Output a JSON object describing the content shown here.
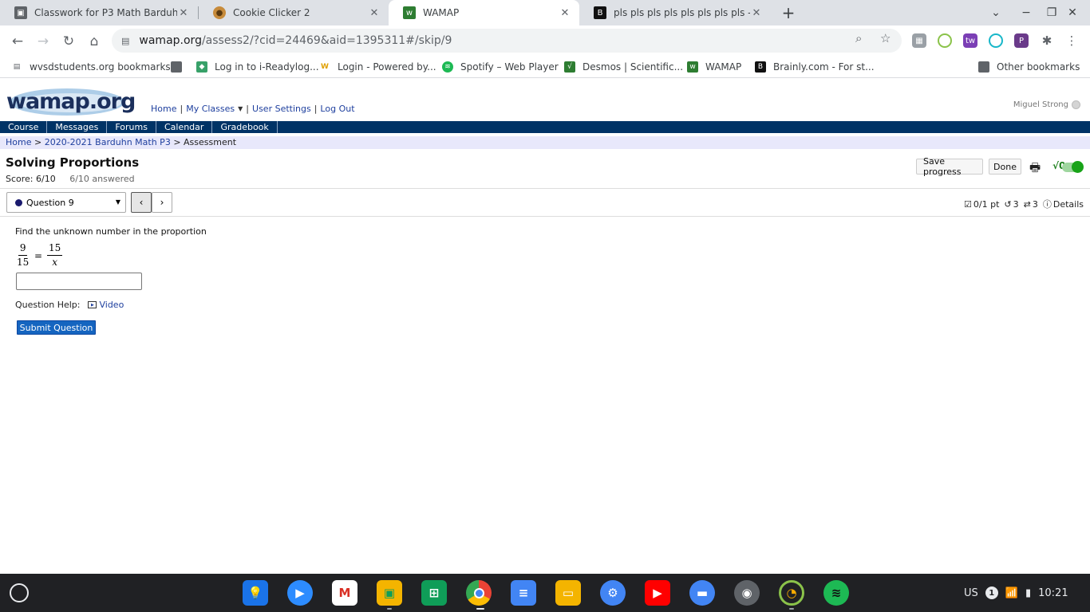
{
  "browser": {
    "tabs": [
      {
        "title": "Classwork for P3 Math Barduhn",
        "icon": "classroom-icon"
      },
      {
        "title": "Cookie Clicker 2",
        "icon": "cookie-icon"
      },
      {
        "title": "WAMAP",
        "icon": "wamap-icon"
      },
      {
        "title": "pls pls pls pls pls pls pls pls -",
        "icon": "brainly-icon"
      }
    ],
    "url_host": "wamap.org",
    "url_path": "/assess2/?cid=24469&aid=1395311#/skip/9",
    "bookmarks": [
      {
        "label": "wvsdstudents.org bookmarks"
      },
      {
        "label": ""
      },
      {
        "label": "Log in to i-Readylog..."
      },
      {
        "label": "Login - Powered by..."
      },
      {
        "label": "Spotify – Web Player"
      },
      {
        "label": "Desmos | Scientific..."
      },
      {
        "label": "WAMAP"
      },
      {
        "label": "Brainly.com - For st..."
      }
    ],
    "other_bookmarks": "Other bookmarks"
  },
  "site": {
    "logo_text": "wamap.org",
    "topnav": {
      "home": "Home",
      "my_classes": "My Classes",
      "user_settings": "User Settings",
      "log_out": "Log Out"
    },
    "user_name": "Miguel Strong",
    "mainnav": [
      "Course",
      "Messages",
      "Forums",
      "Calendar",
      "Gradebook"
    ],
    "breadcrumb": {
      "home": "Home",
      "course": "2020-2021 Barduhn Math P3",
      "current": "Assessment"
    }
  },
  "assessment": {
    "title": "Solving Proportions",
    "score": "Score: 6/10",
    "answered": "6/10 answered",
    "save_progress": "Save progress",
    "done": "Done",
    "math_toggle": "√0",
    "question_select": "Question 9",
    "prev": "‹",
    "next": "›",
    "points": "0/1 pt",
    "retries": "3",
    "regens": "3",
    "details": "Details"
  },
  "question": {
    "prompt": "Find the unknown number in the proportion",
    "left_num": "9",
    "left_den": "15",
    "equals": "=",
    "right_num": "15",
    "right_den": "x",
    "answer_value": "",
    "help_label": "Question Help:",
    "video_label": "Video",
    "submit_label": "Submit Question"
  },
  "taskbar": {
    "locale": "US",
    "notifications": "1",
    "time": "10:21"
  }
}
